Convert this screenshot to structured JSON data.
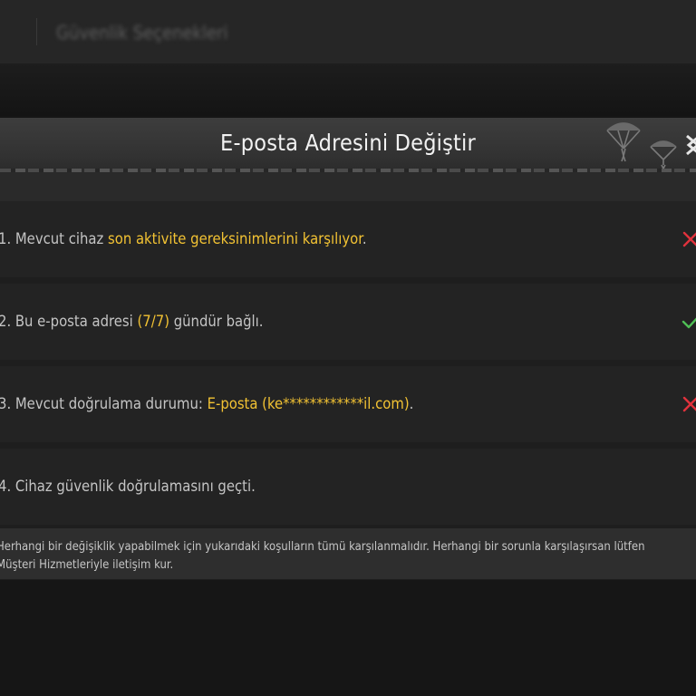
{
  "background": {
    "title": "Güvenlik Seçenekleri"
  },
  "dialog": {
    "title": "E-posta Adresini Değiştir",
    "requirements": [
      {
        "prefix": "1. Mevcut cihaz ",
        "highlight": "son aktivite gereksinimlerini karşılıyor",
        "suffix": ".",
        "status": "fail"
      },
      {
        "prefix": "2. Bu e-posta adresi ",
        "highlight": "(7/7)",
        "suffix": " gündür bağlı.",
        "status": "pass"
      },
      {
        "prefix": "3. Mevcut doğrulama durumu: ",
        "highlight": "E-posta (ke************il.com)",
        "suffix": ".",
        "status": "fail"
      },
      {
        "prefix": "4. Cihaz güvenlik doğrulamasını geçti.",
        "highlight": "",
        "suffix": "",
        "status": "none"
      }
    ],
    "note": {
      "line1": "Herhangi bir değişiklik yapabilmek için yukarıdaki koşulların tümü karşılanmalıdır. Herhangi bir sorunla karşılaşırsan lütfen",
      "line2": "Müşteri Hizmetleriyle iletişim kur."
    }
  },
  "colors": {
    "highlight": "#f2c233",
    "fail": "#e0323c",
    "pass": "#4fbf55"
  },
  "icons": {
    "close": "close-icon",
    "fail": "cross-icon",
    "pass": "check-icon"
  }
}
